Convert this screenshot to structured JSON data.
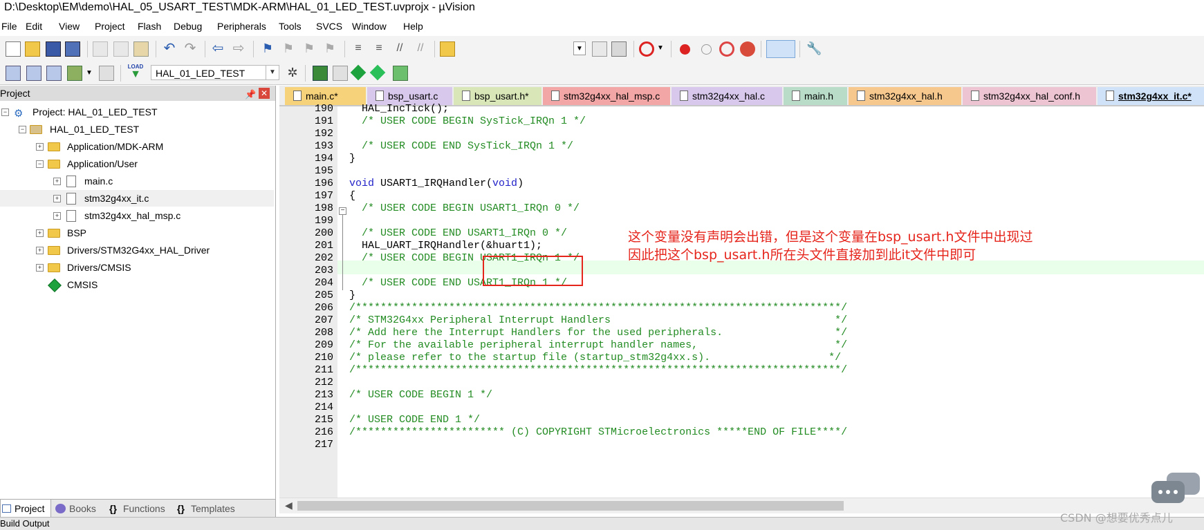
{
  "window": {
    "title": "D:\\Desktop\\EM\\demo\\HAL_05_USART_TEST\\MDK-ARM\\HAL_01_LED_TEST.uvprojx - µVision"
  },
  "menu": [
    "File",
    "Edit",
    "View",
    "Project",
    "Flash",
    "Debug",
    "Peripherals",
    "Tools",
    "SVCS",
    "Window",
    "Help"
  ],
  "toolbar": {
    "target_name": "HAL_01_LED_TEST",
    "load_label": "LOAD"
  },
  "project_panel": {
    "title": "Project",
    "tree": [
      {
        "label": "Project: HAL_01_LED_TEST"
      },
      {
        "label": "HAL_01_LED_TEST"
      },
      {
        "label": "Application/MDK-ARM"
      },
      {
        "label": "Application/User"
      },
      {
        "label": "main.c"
      },
      {
        "label": "stm32g4xx_it.c"
      },
      {
        "label": "stm32g4xx_hal_msp.c"
      },
      {
        "label": "BSP"
      },
      {
        "label": "Drivers/STM32G4xx_HAL_Driver"
      },
      {
        "label": "Drivers/CMSIS"
      },
      {
        "label": "CMSIS"
      }
    ],
    "bottom_tabs": [
      "Project",
      "Books",
      "Functions",
      "Templates"
    ],
    "bottom_tab_glyphs": [
      "{}",
      "{}"
    ]
  },
  "editor_tabs": [
    {
      "label": "main.c*",
      "color": "#f6d27a"
    },
    {
      "label": "bsp_usart.c",
      "color": "#d8c8ec"
    },
    {
      "label": "bsp_usart.h*",
      "color": "#d8e6b8"
    },
    {
      "label": "stm32g4xx_hal_msp.c",
      "color": "#f2a6a6"
    },
    {
      "label": "stm32g4xx_hal.c",
      "color": "#d8c8ec"
    },
    {
      "label": "main.h",
      "color": "#b8dcc8"
    },
    {
      "label": "stm32g4xx_hal.h",
      "color": "#f6c88e"
    },
    {
      "label": "stm32g4xx_hal_conf.h",
      "color": "#ecc4d2"
    },
    {
      "label": "stm32g4xx_it.c*",
      "color": "#cfe2f7"
    }
  ],
  "code_lines": [
    {
      "n": "190",
      "t": "  HAL_IncTick();"
    },
    {
      "n": "191",
      "t": "  /* USER CODE BEGIN SysTick_IRQn 1 */"
    },
    {
      "n": "192",
      "t": ""
    },
    {
      "n": "193",
      "t": "  /* USER CODE END SysTick_IRQn 1 */"
    },
    {
      "n": "194",
      "t": "}"
    },
    {
      "n": "195",
      "t": ""
    },
    {
      "n": "196",
      "t": "void USART1_IRQHandler(void)"
    },
    {
      "n": "197",
      "t": "{"
    },
    {
      "n": "198",
      "t": "  /* USER CODE BEGIN USART1_IRQn 0 */"
    },
    {
      "n": "199",
      "t": ""
    },
    {
      "n": "200",
      "t": "  /* USER CODE END USART1_IRQn 0 */"
    },
    {
      "n": "201",
      "t": "  HAL_UART_IRQHandler(&huart1);"
    },
    {
      "n": "202",
      "t": "  /* USER CODE BEGIN USART1_IRQn 1 */"
    },
    {
      "n": "203",
      "t": ""
    },
    {
      "n": "204",
      "t": "  /* USER CODE END USART1_IRQn 1 */"
    },
    {
      "n": "205",
      "t": "}"
    },
    {
      "n": "206",
      "t": "/******************************************************************************/"
    },
    {
      "n": "207",
      "t": "/* STM32G4xx Peripheral Interrupt Handlers                                    */"
    },
    {
      "n": "208",
      "t": "/* Add here the Interrupt Handlers for the used peripherals.                  */"
    },
    {
      "n": "209",
      "t": "/* For the available peripheral interrupt handler names,                      */"
    },
    {
      "n": "210",
      "t": "/* please refer to the startup file (startup_stm32g4xx.s).                   */"
    },
    {
      "n": "211",
      "t": "/******************************************************************************/"
    },
    {
      "n": "212",
      "t": ""
    },
    {
      "n": "213",
      "t": "/* USER CODE BEGIN 1 */"
    },
    {
      "n": "214",
      "t": ""
    },
    {
      "n": "215",
      "t": "/* USER CODE END 1 */"
    },
    {
      "n": "216",
      "t": "/************************ (C) COPYRIGHT STMicroelectronics *****END OF FILE****/"
    },
    {
      "n": "217",
      "t": ""
    }
  ],
  "annotation": {
    "line1": "这个变量没有声明会出错，但是这个变量在bsp_usart.h文件中出现过",
    "line2": "因此把这个bsp_usart.h所在头文件直接加到此it文件中即可",
    "color": "#e5241b"
  },
  "build_output_label": "Build Output",
  "watermark": "CSDN @想要优秀点儿"
}
